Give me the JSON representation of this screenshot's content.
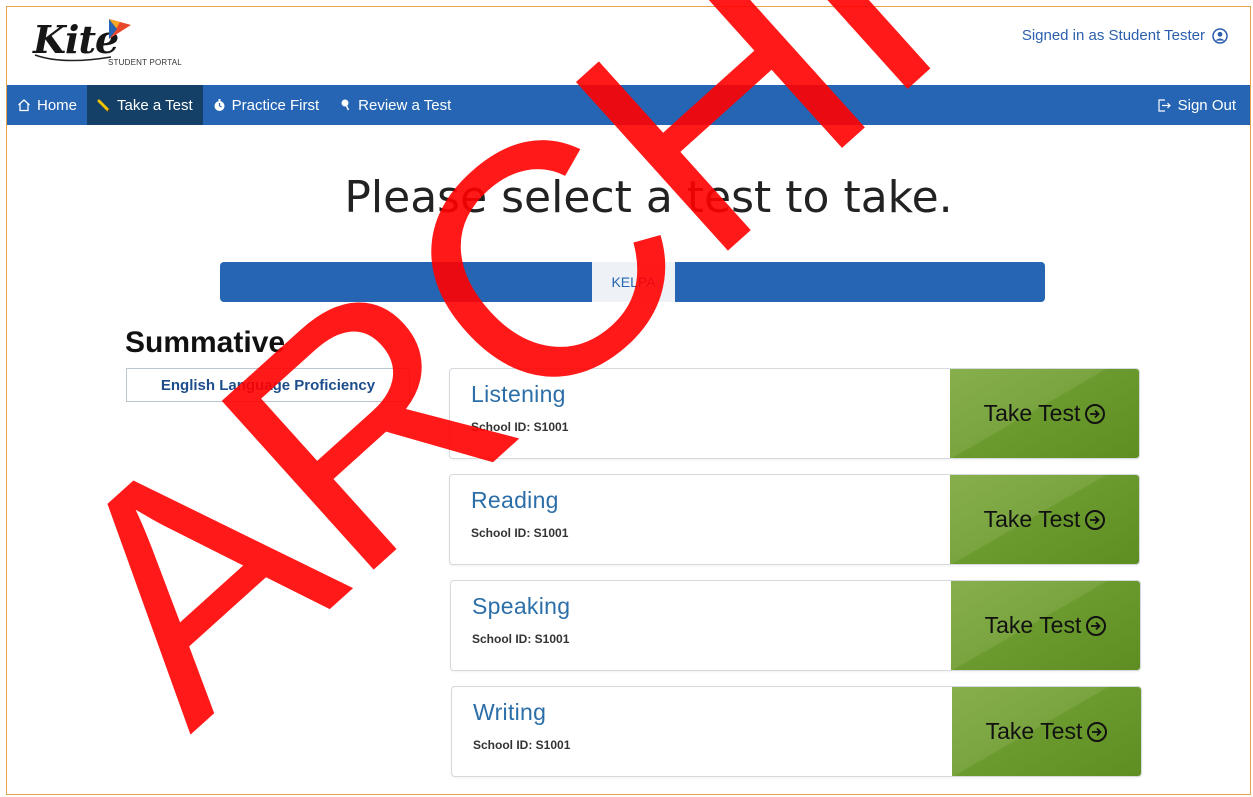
{
  "header": {
    "logo_text": "Kite",
    "logo_subtitle": "STUDENT PORTAL",
    "signed_in_text": "Signed in as Student Tester"
  },
  "nav": {
    "home": "Home",
    "take_test": "Take a Test",
    "practice": "Practice First",
    "review": "Review a Test",
    "sign_out": "Sign Out"
  },
  "main": {
    "title": "Please select a test to take.",
    "tab_label": "KELPA",
    "section_title": "Summative",
    "category": "English Language Proficiency",
    "tests": [
      {
        "name": "Listening",
        "school_id": "School ID: S1001",
        "button": "Take Test"
      },
      {
        "name": "Reading",
        "school_id": "School ID: S1001",
        "button": "Take Test"
      },
      {
        "name": "Speaking",
        "school_id": "School ID: S1001",
        "button": "Take Test"
      },
      {
        "name": "Writing",
        "school_id": "School ID: S1001",
        "button": "Take Test"
      }
    ]
  },
  "watermark": "ARCHIVED",
  "colors": {
    "nav_blue": "#2565b3",
    "nav_active": "#143f66",
    "button_green": "#6b9a2e",
    "link_blue": "#2b6ea8",
    "watermark_red": "#ff0000"
  }
}
